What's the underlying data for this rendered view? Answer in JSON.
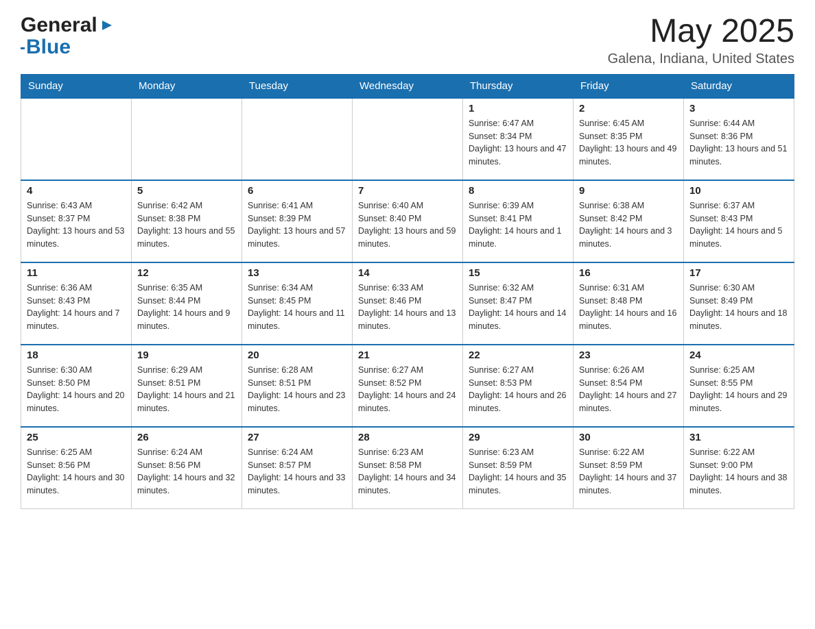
{
  "header": {
    "logo_general": "General",
    "logo_blue": "Blue",
    "month_title": "May 2025",
    "location": "Galena, Indiana, United States"
  },
  "days_of_week": [
    "Sunday",
    "Monday",
    "Tuesday",
    "Wednesday",
    "Thursday",
    "Friday",
    "Saturday"
  ],
  "weeks": [
    [
      {
        "day": "",
        "sunrise": "",
        "sunset": "",
        "daylight": ""
      },
      {
        "day": "",
        "sunrise": "",
        "sunset": "",
        "daylight": ""
      },
      {
        "day": "",
        "sunrise": "",
        "sunset": "",
        "daylight": ""
      },
      {
        "day": "",
        "sunrise": "",
        "sunset": "",
        "daylight": ""
      },
      {
        "day": "1",
        "sunrise": "Sunrise: 6:47 AM",
        "sunset": "Sunset: 8:34 PM",
        "daylight": "Daylight: 13 hours and 47 minutes."
      },
      {
        "day": "2",
        "sunrise": "Sunrise: 6:45 AM",
        "sunset": "Sunset: 8:35 PM",
        "daylight": "Daylight: 13 hours and 49 minutes."
      },
      {
        "day": "3",
        "sunrise": "Sunrise: 6:44 AM",
        "sunset": "Sunset: 8:36 PM",
        "daylight": "Daylight: 13 hours and 51 minutes."
      }
    ],
    [
      {
        "day": "4",
        "sunrise": "Sunrise: 6:43 AM",
        "sunset": "Sunset: 8:37 PM",
        "daylight": "Daylight: 13 hours and 53 minutes."
      },
      {
        "day": "5",
        "sunrise": "Sunrise: 6:42 AM",
        "sunset": "Sunset: 8:38 PM",
        "daylight": "Daylight: 13 hours and 55 minutes."
      },
      {
        "day": "6",
        "sunrise": "Sunrise: 6:41 AM",
        "sunset": "Sunset: 8:39 PM",
        "daylight": "Daylight: 13 hours and 57 minutes."
      },
      {
        "day": "7",
        "sunrise": "Sunrise: 6:40 AM",
        "sunset": "Sunset: 8:40 PM",
        "daylight": "Daylight: 13 hours and 59 minutes."
      },
      {
        "day": "8",
        "sunrise": "Sunrise: 6:39 AM",
        "sunset": "Sunset: 8:41 PM",
        "daylight": "Daylight: 14 hours and 1 minute."
      },
      {
        "day": "9",
        "sunrise": "Sunrise: 6:38 AM",
        "sunset": "Sunset: 8:42 PM",
        "daylight": "Daylight: 14 hours and 3 minutes."
      },
      {
        "day": "10",
        "sunrise": "Sunrise: 6:37 AM",
        "sunset": "Sunset: 8:43 PM",
        "daylight": "Daylight: 14 hours and 5 minutes."
      }
    ],
    [
      {
        "day": "11",
        "sunrise": "Sunrise: 6:36 AM",
        "sunset": "Sunset: 8:43 PM",
        "daylight": "Daylight: 14 hours and 7 minutes."
      },
      {
        "day": "12",
        "sunrise": "Sunrise: 6:35 AM",
        "sunset": "Sunset: 8:44 PM",
        "daylight": "Daylight: 14 hours and 9 minutes."
      },
      {
        "day": "13",
        "sunrise": "Sunrise: 6:34 AM",
        "sunset": "Sunset: 8:45 PM",
        "daylight": "Daylight: 14 hours and 11 minutes."
      },
      {
        "day": "14",
        "sunrise": "Sunrise: 6:33 AM",
        "sunset": "Sunset: 8:46 PM",
        "daylight": "Daylight: 14 hours and 13 minutes."
      },
      {
        "day": "15",
        "sunrise": "Sunrise: 6:32 AM",
        "sunset": "Sunset: 8:47 PM",
        "daylight": "Daylight: 14 hours and 14 minutes."
      },
      {
        "day": "16",
        "sunrise": "Sunrise: 6:31 AM",
        "sunset": "Sunset: 8:48 PM",
        "daylight": "Daylight: 14 hours and 16 minutes."
      },
      {
        "day": "17",
        "sunrise": "Sunrise: 6:30 AM",
        "sunset": "Sunset: 8:49 PM",
        "daylight": "Daylight: 14 hours and 18 minutes."
      }
    ],
    [
      {
        "day": "18",
        "sunrise": "Sunrise: 6:30 AM",
        "sunset": "Sunset: 8:50 PM",
        "daylight": "Daylight: 14 hours and 20 minutes."
      },
      {
        "day": "19",
        "sunrise": "Sunrise: 6:29 AM",
        "sunset": "Sunset: 8:51 PM",
        "daylight": "Daylight: 14 hours and 21 minutes."
      },
      {
        "day": "20",
        "sunrise": "Sunrise: 6:28 AM",
        "sunset": "Sunset: 8:51 PM",
        "daylight": "Daylight: 14 hours and 23 minutes."
      },
      {
        "day": "21",
        "sunrise": "Sunrise: 6:27 AM",
        "sunset": "Sunset: 8:52 PM",
        "daylight": "Daylight: 14 hours and 24 minutes."
      },
      {
        "day": "22",
        "sunrise": "Sunrise: 6:27 AM",
        "sunset": "Sunset: 8:53 PM",
        "daylight": "Daylight: 14 hours and 26 minutes."
      },
      {
        "day": "23",
        "sunrise": "Sunrise: 6:26 AM",
        "sunset": "Sunset: 8:54 PM",
        "daylight": "Daylight: 14 hours and 27 minutes."
      },
      {
        "day": "24",
        "sunrise": "Sunrise: 6:25 AM",
        "sunset": "Sunset: 8:55 PM",
        "daylight": "Daylight: 14 hours and 29 minutes."
      }
    ],
    [
      {
        "day": "25",
        "sunrise": "Sunrise: 6:25 AM",
        "sunset": "Sunset: 8:56 PM",
        "daylight": "Daylight: 14 hours and 30 minutes."
      },
      {
        "day": "26",
        "sunrise": "Sunrise: 6:24 AM",
        "sunset": "Sunset: 8:56 PM",
        "daylight": "Daylight: 14 hours and 32 minutes."
      },
      {
        "day": "27",
        "sunrise": "Sunrise: 6:24 AM",
        "sunset": "Sunset: 8:57 PM",
        "daylight": "Daylight: 14 hours and 33 minutes."
      },
      {
        "day": "28",
        "sunrise": "Sunrise: 6:23 AM",
        "sunset": "Sunset: 8:58 PM",
        "daylight": "Daylight: 14 hours and 34 minutes."
      },
      {
        "day": "29",
        "sunrise": "Sunrise: 6:23 AM",
        "sunset": "Sunset: 8:59 PM",
        "daylight": "Daylight: 14 hours and 35 minutes."
      },
      {
        "day": "30",
        "sunrise": "Sunrise: 6:22 AM",
        "sunset": "Sunset: 8:59 PM",
        "daylight": "Daylight: 14 hours and 37 minutes."
      },
      {
        "day": "31",
        "sunrise": "Sunrise: 6:22 AM",
        "sunset": "Sunset: 9:00 PM",
        "daylight": "Daylight: 14 hours and 38 minutes."
      }
    ]
  ]
}
